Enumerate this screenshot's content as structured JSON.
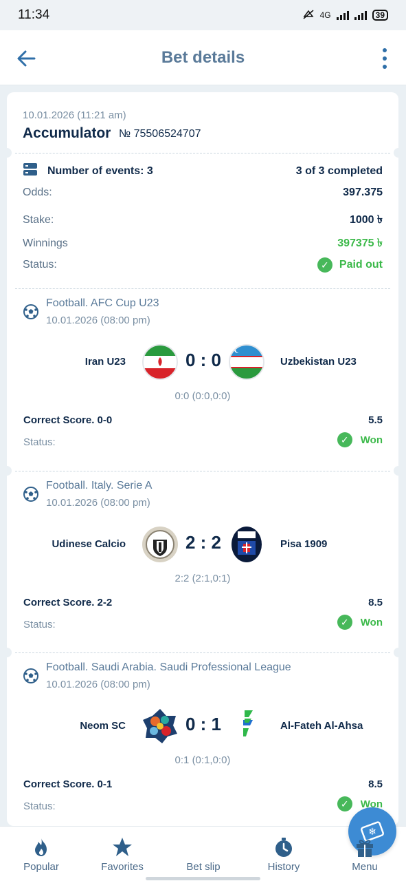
{
  "status_bar": {
    "time": "11:34",
    "network": "4G",
    "battery": "39"
  },
  "header": {
    "title": "Bet details"
  },
  "bet": {
    "date": "10.01.2026 (11:21 am)",
    "type": "Accumulator",
    "number": "№ 75506524707",
    "events_label": "Number of events: 3",
    "events_value": "3 of 3 completed",
    "odds_label": "Odds:",
    "odds_value": "397.375",
    "stake_label": "Stake:",
    "stake_value": "1000 ৳",
    "winnings_label": "Winnings",
    "winnings_value": "397375 ৳",
    "status_label": "Status:",
    "status_value": "Paid out"
  },
  "events": [
    {
      "league": "Football. AFC Cup U23",
      "date": "10.01.2026 (08:00 pm)",
      "home": "Iran U23",
      "away": "Uzbekistan U23",
      "score": "0 : 0",
      "detail": "0:0 (0:0,0:0)",
      "pick": "Correct Score. 0-0",
      "odd": "5.5",
      "status_label": "Status:",
      "status": "Won",
      "home_logo": "iran-flag-icon",
      "away_logo": "uzbekistan-flag-icon"
    },
    {
      "league": "Football. Italy. Serie A",
      "date": "10.01.2026 (08:00 pm)",
      "home": "Udinese Calcio",
      "away": "Pisa 1909",
      "score": "2 : 2",
      "detail": "2:2 (2:1,0:1)",
      "pick": "Correct Score. 2-2",
      "odd": "8.5",
      "status_label": "Status:",
      "status": "Won",
      "home_logo": "udinese-crest-icon",
      "away_logo": "pisa-crest-icon"
    },
    {
      "league": "Football. Saudi Arabia. Saudi Professional League",
      "date": "10.01.2026 (08:00 pm)",
      "home": "Neom SC",
      "away": "Al-Fateh Al-Ahsa",
      "score": "0 : 1",
      "detail": "0:1 (0:1,0:0)",
      "pick": "Correct Score. 0-1",
      "odd": "8.5",
      "status_label": "Status:",
      "status": "Won",
      "home_logo": "neom-crest-icon",
      "away_logo": "al-fateh-crest-icon"
    }
  ],
  "nav": {
    "popular": "Popular",
    "favorites": "Favorites",
    "betslip": "Bet slip",
    "history": "History",
    "menu": "Menu"
  },
  "colors": {
    "accent": "#3d8bd4",
    "win": "#3cb94a",
    "text_dark": "#102a4a"
  }
}
